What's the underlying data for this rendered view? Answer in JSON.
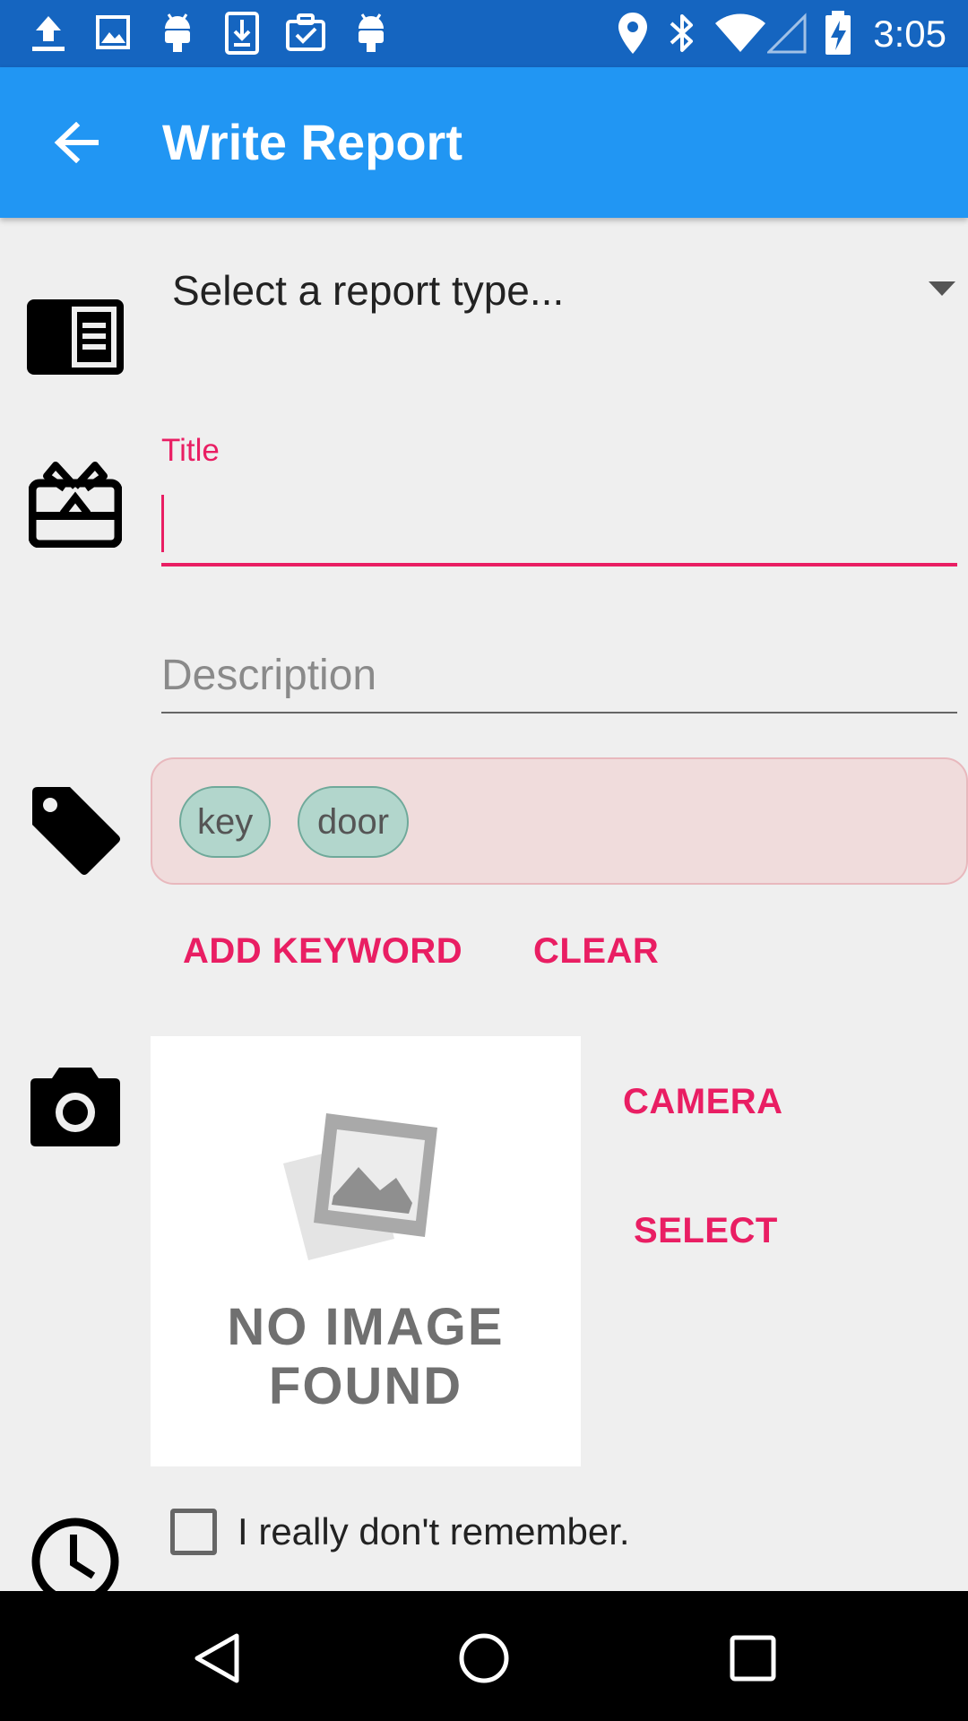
{
  "status_bar": {
    "time": "3:05",
    "left_icons": [
      "upload-icon",
      "image-icon",
      "android-icon",
      "download-icon",
      "clipboard-check-icon",
      "android-icon"
    ],
    "right_icons": [
      "location-icon",
      "bluetooth-icon",
      "wifi-icon",
      "signal-icon",
      "battery-charging-icon"
    ]
  },
  "app_bar": {
    "title": "Write Report",
    "back_icon": "arrow-back-icon",
    "background": "#2196f3"
  },
  "form": {
    "report_type": {
      "selected": "Select a report type...",
      "icon": "report-icon"
    },
    "title": {
      "label": "Title",
      "value": "",
      "icon": "redeem-icon"
    },
    "description": {
      "placeholder": "Description",
      "value": ""
    },
    "keywords": {
      "icon": "tag-icon",
      "chips": [
        "key",
        "door"
      ],
      "add_label": "ADD KEYWORD",
      "clear_label": "CLEAR"
    },
    "image": {
      "icon": "camera-icon",
      "placeholder_line1": "NO IMAGE",
      "placeholder_line2": "FOUND",
      "camera_label": "CAMERA",
      "select_label": "SELECT"
    },
    "time": {
      "icon": "clock-icon",
      "checkbox_label": "I really don't remember.",
      "checked": false
    }
  },
  "colors": {
    "accent": "#e91e63",
    "primary": "#2196f3",
    "primary_dark": "#1565c0",
    "chip_fill": "#b2d6cc",
    "keyword_box": "#f0dcdc"
  },
  "nav_bar": {
    "icons": [
      "back-triangle-icon",
      "home-circle-icon",
      "recents-square-icon"
    ]
  }
}
